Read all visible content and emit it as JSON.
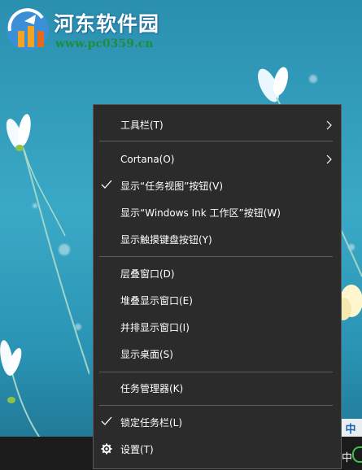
{
  "watermark": {
    "title": "河东软件园",
    "url": "www.pc0359.cn"
  },
  "context_menu": {
    "items": [
      {
        "label": "工具栏(T)",
        "submenu": true,
        "checked": false
      },
      {
        "label": "Cortana(O)",
        "submenu": true,
        "checked": false
      },
      {
        "label": "显示“任务视图”按钮(V)",
        "submenu": false,
        "checked": true
      },
      {
        "label": "显示“Windows Ink 工作区”按钮(W)",
        "submenu": false,
        "checked": false
      },
      {
        "label": "显示触摸键盘按钮(Y)",
        "submenu": false,
        "checked": false
      },
      {
        "label": "层叠窗口(D)",
        "submenu": false,
        "checked": false
      },
      {
        "label": "堆叠显示窗口(E)",
        "submenu": false,
        "checked": false
      },
      {
        "label": "并排显示窗口(I)",
        "submenu": false,
        "checked": false
      },
      {
        "label": "显示桌面(S)",
        "submenu": false,
        "checked": false
      },
      {
        "label": "任务管理器(K)",
        "submenu": false,
        "checked": false
      },
      {
        "label": "锁定任务栏(L)",
        "submenu": false,
        "checked": true
      },
      {
        "label": "设置(T)",
        "submenu": false,
        "checked": false,
        "icon": "gear-icon"
      }
    ]
  },
  "taskbar": {
    "ime_label": "中",
    "tray_ime": "中"
  },
  "colors": {
    "menu_bg": "#2b2b2b",
    "menu_text": "#ffffff",
    "separator": "#5c5c5c",
    "taskbar_bg": "#1b1b1b",
    "desktop_bg": "#3aa9c6"
  }
}
